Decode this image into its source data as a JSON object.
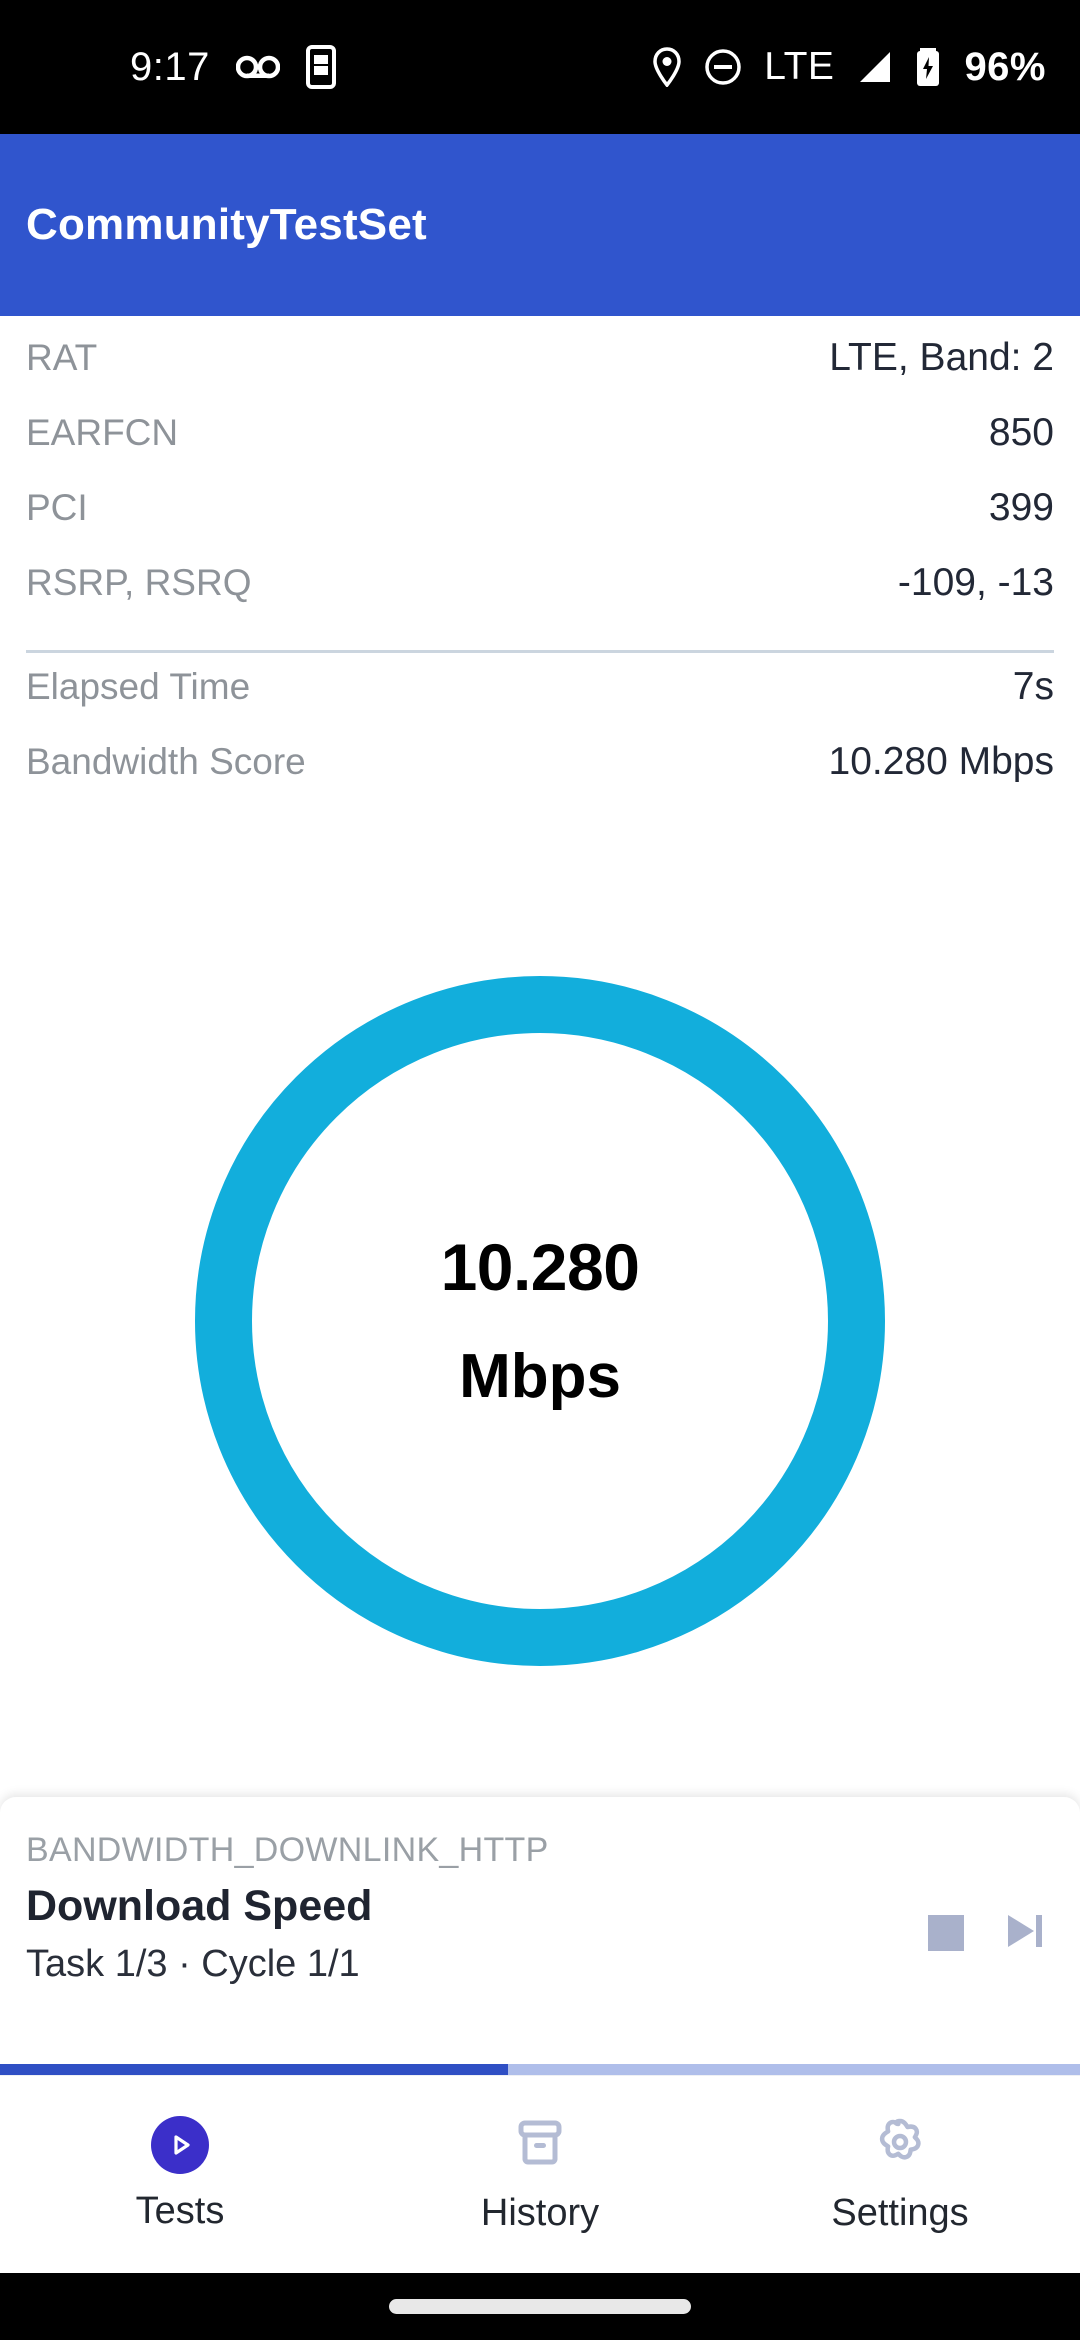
{
  "status_bar": {
    "time": "9:17",
    "network_type": "LTE",
    "battery_percent": "96%",
    "icons": [
      "voicemail-icon",
      "adb-phone-icon",
      "location-pin-icon",
      "do-not-disturb-icon",
      "signal-bars-icon",
      "battery-charging-icon"
    ]
  },
  "app_bar": {
    "title": "CommunityTestSet",
    "background_color": "#3055CD"
  },
  "info": {
    "primary_rows": [
      {
        "label": "RAT",
        "value": "LTE, Band: 2"
      },
      {
        "label": "EARFCN",
        "value": "850"
      },
      {
        "label": "PCI",
        "value": "399"
      },
      {
        "label": "RSRP, RSRQ",
        "value": "-109, -13"
      }
    ],
    "secondary_rows": [
      {
        "label": "Elapsed Time",
        "value": "7s"
      },
      {
        "label": "Bandwidth Score",
        "value": "10.280 Mbps"
      }
    ]
  },
  "gauge": {
    "value": "10.280",
    "unit": "Mbps",
    "ring_color": "#12AEDC"
  },
  "task_card": {
    "code": "BANDWIDTH_DOWNLINK_HTTP",
    "title": "Download Speed",
    "subtitle": "Task 1/3 · Cycle 1/1",
    "controls": [
      {
        "name": "stop-button",
        "icon": "stop-icon"
      },
      {
        "name": "skip-next-button",
        "icon": "skip-next-icon"
      }
    ],
    "progress_percent": 47,
    "progress_fill_color": "#2F4FC4",
    "progress_track_color": "#AFBEEA"
  },
  "bottom_nav": {
    "items": [
      {
        "label": "Tests",
        "icon": "play-circle-icon",
        "active": true
      },
      {
        "label": "History",
        "icon": "archive-icon",
        "active": false
      },
      {
        "label": "Settings",
        "icon": "gear-icon",
        "active": false
      }
    ],
    "active_color": "#3B2FC9",
    "inactive_color": "#B4BCD4"
  }
}
